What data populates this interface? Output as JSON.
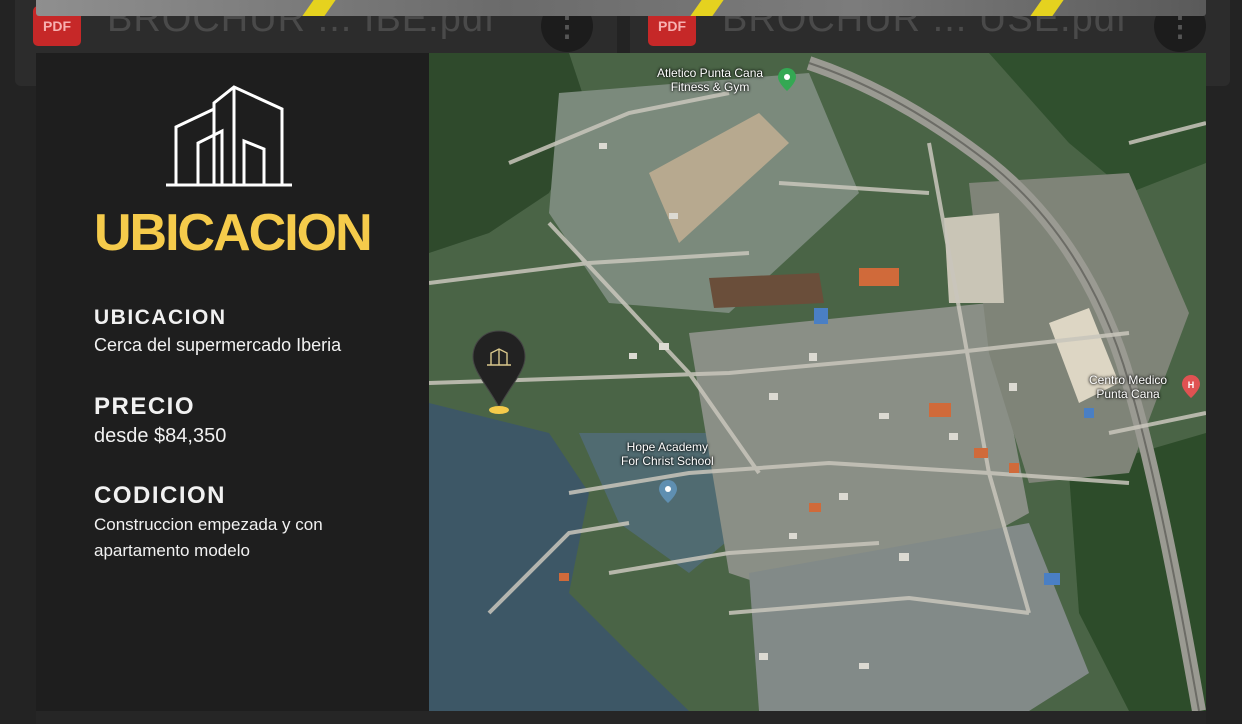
{
  "files": [
    {
      "badge": "PDF",
      "name": "BROCHUR ... IBE.pdf",
      "more": "⋮"
    },
    {
      "badge": "PDF",
      "name": "BROCHUR ... USE.pdf",
      "more": "⋮"
    }
  ],
  "slide": {
    "heading": "UBICACION",
    "location": {
      "label": "UBICACION",
      "value": "Cerca del supermercado Iberia"
    },
    "price": {
      "label": "PRECIO",
      "value": "desde $84,350"
    },
    "condition": {
      "label": "CODICION",
      "value": "Construccion empezada y con apartamento modelo"
    },
    "accent_color": "#f5cb4b"
  },
  "map": {
    "places": [
      {
        "name": "Atletico Punta Cana Fitness & Gym",
        "line1": "Atletico Punta Cana",
        "line2": "Fitness & Gym",
        "icon": "green-pin-icon"
      },
      {
        "name": "Centro Medico Punta Cana",
        "line1": "Centro Medico",
        "line2": "Punta Cana",
        "icon": "hospital-pin-icon"
      },
      {
        "name": "Hope Academy For Christ School",
        "line1": "Hope Academy",
        "line2": "For Christ School",
        "icon": "school-pin-icon"
      }
    ],
    "marker_icon": "building-pin-icon"
  }
}
